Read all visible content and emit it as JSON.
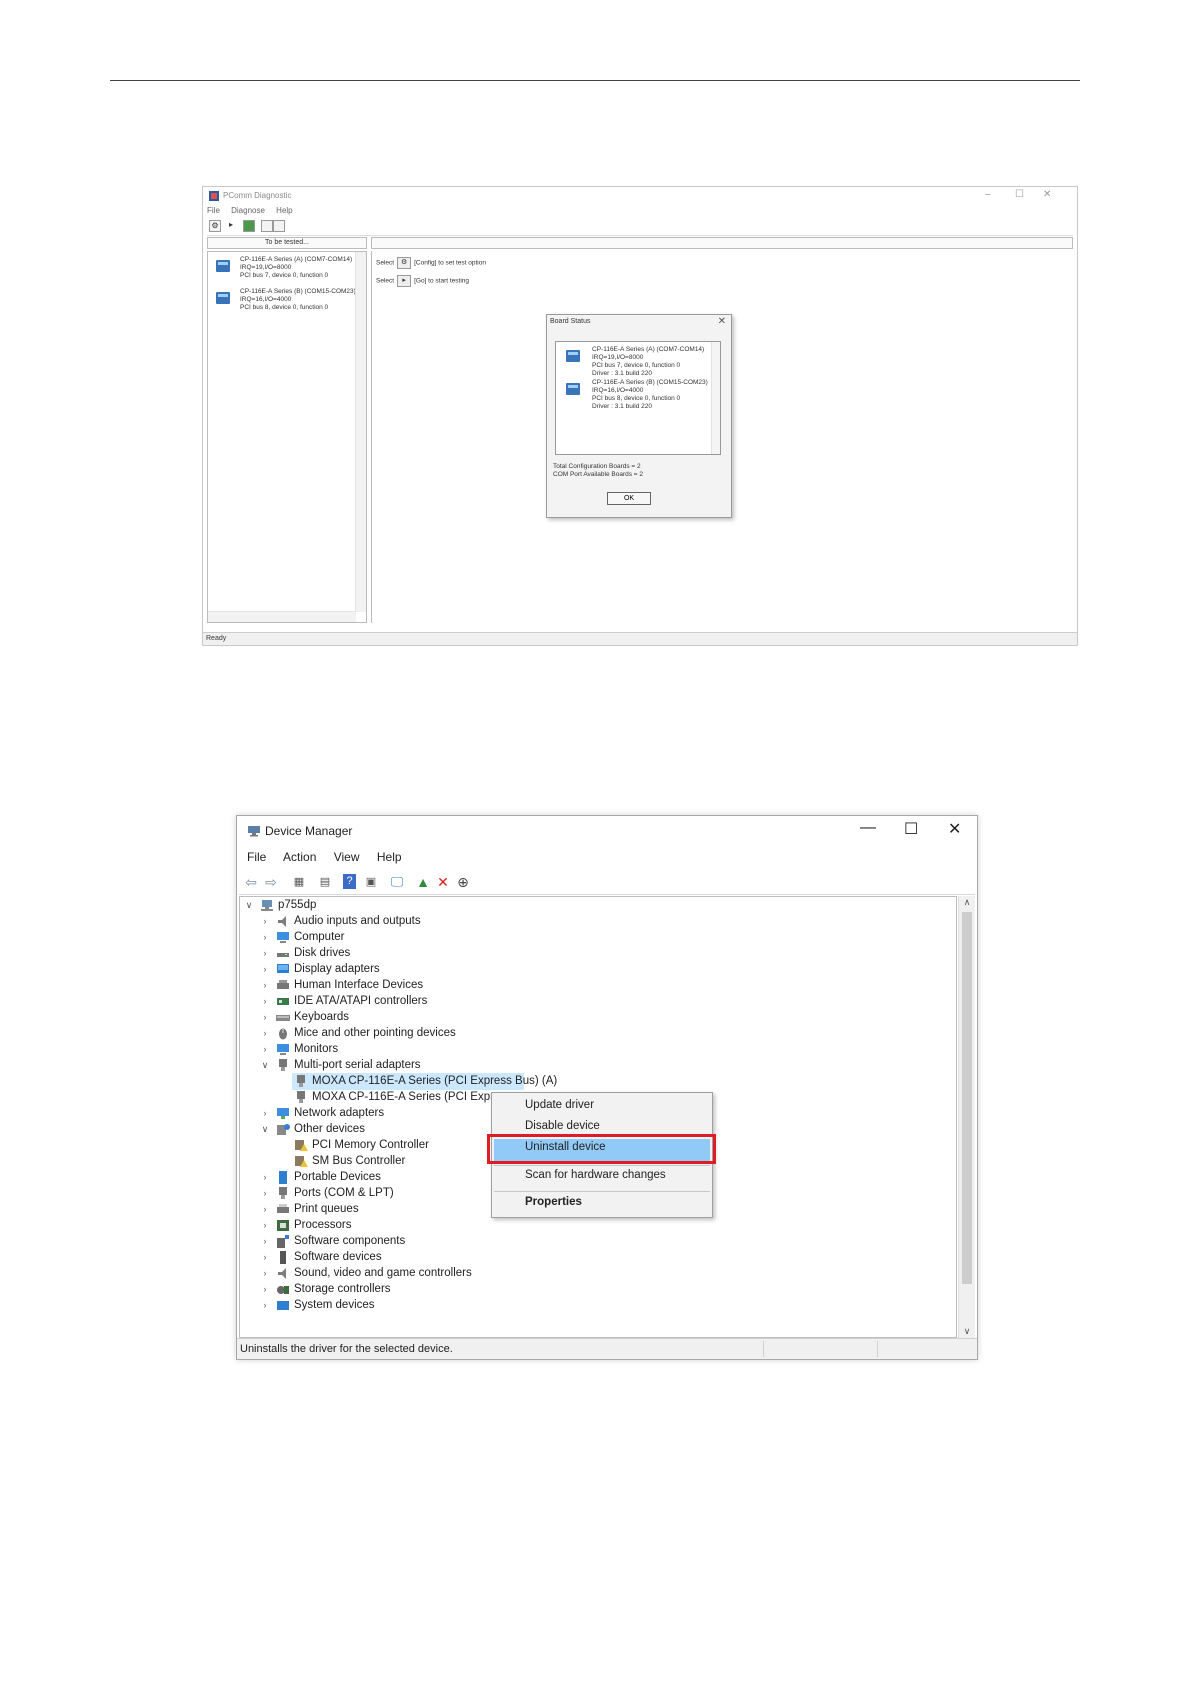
{
  "pcomm": {
    "title": "PComm Diagnostic",
    "menu": [
      "File",
      "Diagnose",
      "Help"
    ],
    "left_header": "To be tested...",
    "boards": [
      {
        "line1": "CP-116E-A Series (A) (COM7-COM14)",
        "line2": "IRQ=19,I/O=8000",
        "line3": "PCI bus 7, device 0, function 0"
      },
      {
        "line1": "CP-116E-A Series (B) (COM15-COM23)",
        "line2": "IRQ=16,I/O=4000",
        "line3": "PCI bus 8, device 0, function 0"
      }
    ],
    "hint_config": {
      "prefix": "Select",
      "suffix": "[Config] to set test option"
    },
    "hint_go": {
      "prefix": "Select",
      "suffix": "[Go] to start testing"
    },
    "status": "Ready",
    "dialog": {
      "title": "Board Status",
      "boards": [
        {
          "line1": "CP-116E-A Series (A) (COM7-COM14)",
          "line2": "IRQ=19,I/O=8000",
          "line3": "PCI bus 7, device 0, function 0",
          "line4": "Driver : 3.1 build 220"
        },
        {
          "line1": "CP-116E-A Series (B) (COM15-COM23)",
          "line2": "IRQ=16,I/O=4000",
          "line3": "PCI bus 8, device 0, function 0",
          "line4": "Driver : 3.1 build 220"
        }
      ],
      "total_boards": "Total Configuration Boards = 2",
      "available_boards": "COM Port Available Boards = 2",
      "ok_label": "OK"
    }
  },
  "devmgr": {
    "title": "Device Manager",
    "menu": [
      "File",
      "Action",
      "View",
      "Help"
    ],
    "root": "p755dp",
    "categories": [
      "Audio inputs and outputs",
      "Computer",
      "Disk drives",
      "Display adapters",
      "Human Interface Devices",
      "IDE ATA/ATAPI controllers",
      "Keyboards",
      "Mice and other pointing devices",
      "Monitors"
    ],
    "multiport": {
      "label": "Multi-port serial adapters",
      "children": [
        "MOXA CP-116E-A Series (PCI Express Bus) (A)",
        "MOXA CP-116E-A Series (PCI Expre"
      ]
    },
    "network": "Network adapters",
    "other": {
      "label": "Other devices",
      "children": [
        "PCI Memory Controller",
        "SM Bus Controller"
      ]
    },
    "more_categories": [
      "Portable Devices",
      "Ports (COM & LPT)",
      "Print queues",
      "Processors",
      "Software components",
      "Software devices",
      "Sound, video and game controllers",
      "Storage controllers",
      "System devices"
    ],
    "status": "Uninstalls the driver for the selected device.",
    "context_menu": {
      "update": "Update driver",
      "disable": "Disable device",
      "uninstall": "Uninstall device",
      "scan": "Scan for hardware changes",
      "properties": "Properties"
    },
    "highlight_color": "#e01b24"
  }
}
